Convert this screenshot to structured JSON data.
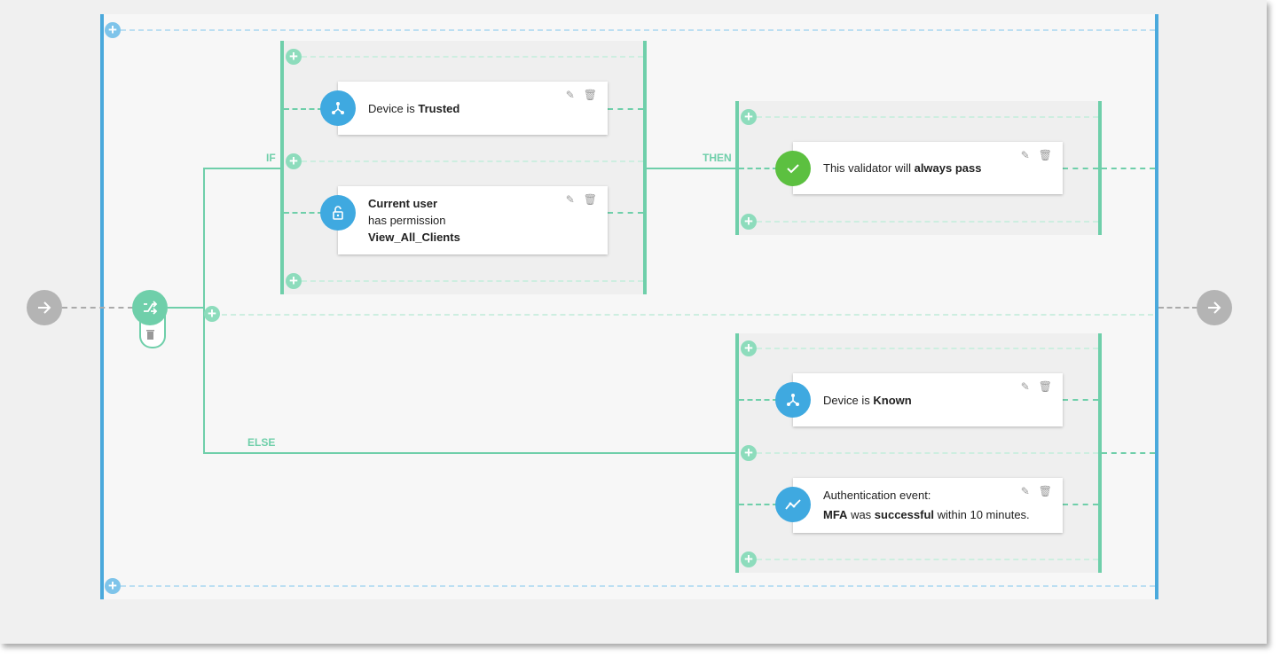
{
  "labels": {
    "if": "IF",
    "then": "THEN",
    "else": "ELSE"
  },
  "cards": {
    "trusted": {
      "prefix": "Device is ",
      "strong": "Trusted"
    },
    "permission": {
      "line1": "Current user",
      "line2": "has permission",
      "line3": "View_All_Clients"
    },
    "validator": {
      "prefix": "This validator will ",
      "strong": "always pass"
    },
    "known": {
      "prefix": "Device is ",
      "strong": "Known"
    },
    "auth": {
      "line1": "Authentication event:",
      "strong1": "MFA",
      "mid": " was ",
      "strong2": "successful",
      "suffix": " within 10 minutes."
    }
  },
  "icons": {
    "add": "plus-icon",
    "edit": "pencil-icon",
    "delete": "trash-icon",
    "device": "network-nodes-icon",
    "permission": "unlock-icon",
    "pass": "check-icon",
    "auth": "trend-line-icon",
    "branch": "shuffle-icon",
    "entry": "arrow-right-icon",
    "exit": "arrow-right-icon"
  },
  "colors": {
    "rail": "#4aa9dc",
    "branch": "#6fcfaa",
    "pass": "#5cc040",
    "node": "#3fa9e0"
  }
}
